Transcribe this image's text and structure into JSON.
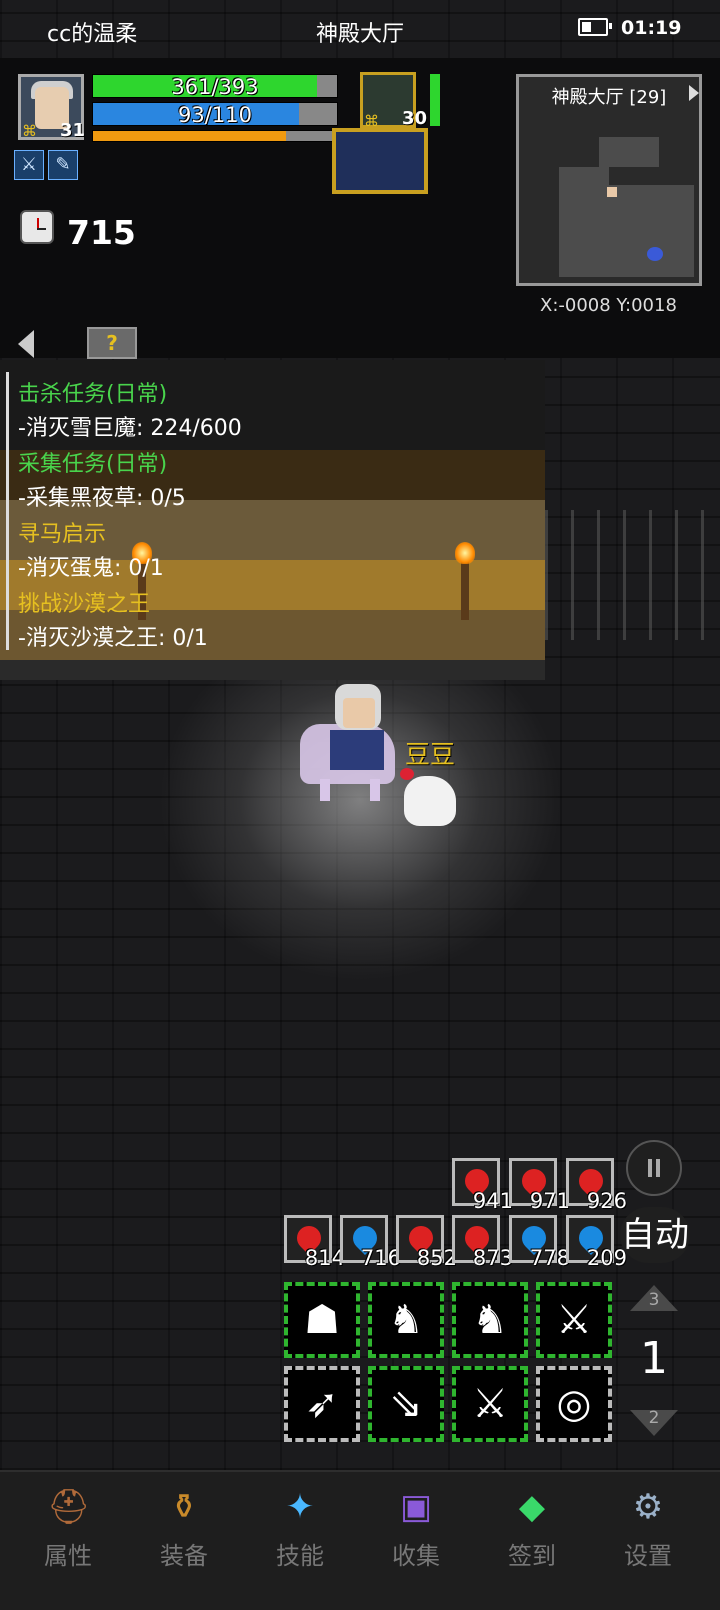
{
  "status_bar": {
    "left": "cc的温柔",
    "center": "神殿大厅",
    "time": "01:19"
  },
  "player": {
    "level": "31",
    "hp": "361/393",
    "hp_fraction": 0.918,
    "mp": "93/110",
    "mp_fraction": 0.845,
    "exp_fraction": 0.79
  },
  "pet": {
    "level": "30",
    "name": "豆豆"
  },
  "timer": "715",
  "minimap": {
    "title": "神殿大厅 [29]",
    "coords": "X:-0008  Y:0018"
  },
  "help_icon": "?",
  "quests": [
    {
      "title": "击杀任务(日常)",
      "detail": "-消灭雪巨魔: 224/600",
      "color": "green"
    },
    {
      "title": "采集任务(日常)",
      "detail": "-采集黑夜草: 0/5",
      "color": "green"
    },
    {
      "title": "寻马启示",
      "detail": "-消灭蛋鬼: 0/1",
      "color": "yellow"
    },
    {
      "title": "挑战沙漠之王",
      "detail": "-消灭沙漠之王: 0/1",
      "color": "yellow"
    }
  ],
  "auto_label": "自动",
  "potions_row1": [
    {
      "count": "941",
      "color": "red"
    },
    {
      "count": "971",
      "color": "red"
    },
    {
      "count": "926",
      "color": "red"
    }
  ],
  "potions_row2": [
    {
      "count": "814",
      "color": "red"
    },
    {
      "count": "716",
      "color": "blue"
    },
    {
      "count": "852",
      "color": "red"
    },
    {
      "count": "873",
      "color": "red"
    },
    {
      "count": "778",
      "color": "blue"
    },
    {
      "count": "209",
      "color": "blue"
    }
  ],
  "skill_page": {
    "up": "3",
    "current": "1",
    "down": "2"
  },
  "skills_row1": [
    "horned-helm-icon",
    "knight-sword-icon",
    "knight-sword-icon",
    "sword-strike-icon"
  ],
  "skills_row2": [
    "arrow-strike-icon",
    "double-arrow-icon",
    "sword-strike-icon",
    "spiral-icon"
  ],
  "nav": [
    {
      "label": "属性",
      "icon": "helmet-icon"
    },
    {
      "label": "装备",
      "icon": "pot-icon"
    },
    {
      "label": "技能",
      "icon": "crystal-icon"
    },
    {
      "label": "收集",
      "icon": "book-icon"
    },
    {
      "label": "签到",
      "icon": "gem-icon"
    },
    {
      "label": "设置",
      "icon": "gear-icon"
    }
  ]
}
